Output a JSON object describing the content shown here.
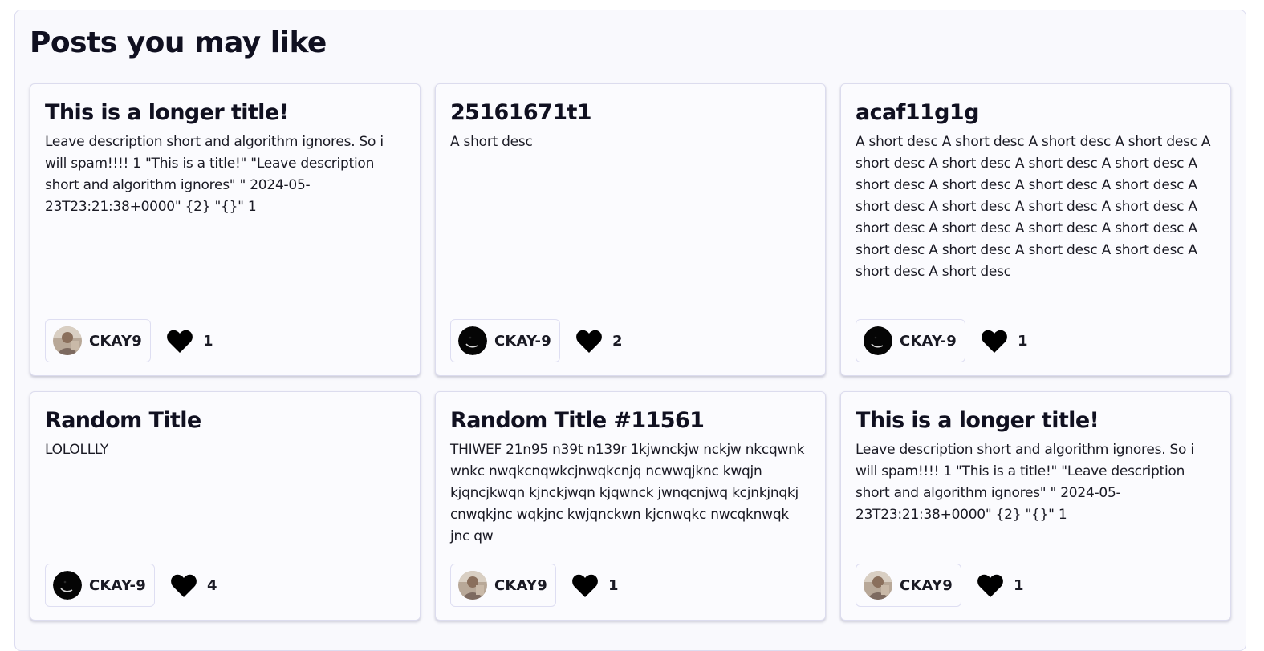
{
  "section": {
    "title": "Posts you may like"
  },
  "posts": [
    {
      "title": "This is a longer title!",
      "description": "Leave description short and algorithm ignores. So i will spam!!!! 1 \"This is a title!\" \"Leave description short and algorithm ignores\" \" 2024-05-23T23:21:38+0000\" {2} \"{}\" 1",
      "author": "CKAY9",
      "avatar_icon": "photo-avatar-icon",
      "likes": "1"
    },
    {
      "title": "25161671t1",
      "description": "A short desc",
      "author": "CKAY-9",
      "avatar_icon": "dark-avatar-icon",
      "likes": "2"
    },
    {
      "title": "acaf11g1g",
      "description": "A short desc A short desc A short desc A short desc A short desc A short desc A short desc A short desc A short desc A short desc A short desc A short desc A short desc A short desc A short desc A short desc A short desc A short desc A short desc A short desc A short desc A short desc A short desc A short desc A short desc A short desc",
      "author": "CKAY-9",
      "avatar_icon": "dark-avatar-icon",
      "likes": "1"
    },
    {
      "title": "Random Title",
      "description": "LOLOLLLY",
      "author": "CKAY-9",
      "avatar_icon": "dark-avatar-icon",
      "likes": "4"
    },
    {
      "title": "Random Title #11561",
      "description": "THIWEF 21n95 n39t n139r 1kjwnckjw nckjw nkcqwnk wnkc nwqkcnqwkcjnwqkcnjq ncwwqjknc kwqjn kjqncjkwqn kjnckjwqn kjqwnck jwnqcnjwq kcjnkjnqkj cnwqkjnc wqkjnc kwjqnckwn kjcnwqkc nwcqknwqk jnc qw",
      "author": "CKAY9",
      "avatar_icon": "photo-avatar-icon",
      "likes": "1"
    },
    {
      "title": "This is a longer title!",
      "description": "Leave description short and algorithm ignores. So i will spam!!!! 1 \"This is a title!\" \"Leave description short and algorithm ignores\" \" 2024-05-23T23:21:38+0000\" {2} \"{}\" 1",
      "author": "CKAY9",
      "avatar_icon": "photo-avatar-icon",
      "likes": "1"
    }
  ],
  "colors": {
    "background": "#f9f9fd",
    "card_border": "#dcdcee",
    "text": "#101020",
    "heart": "#000000"
  }
}
